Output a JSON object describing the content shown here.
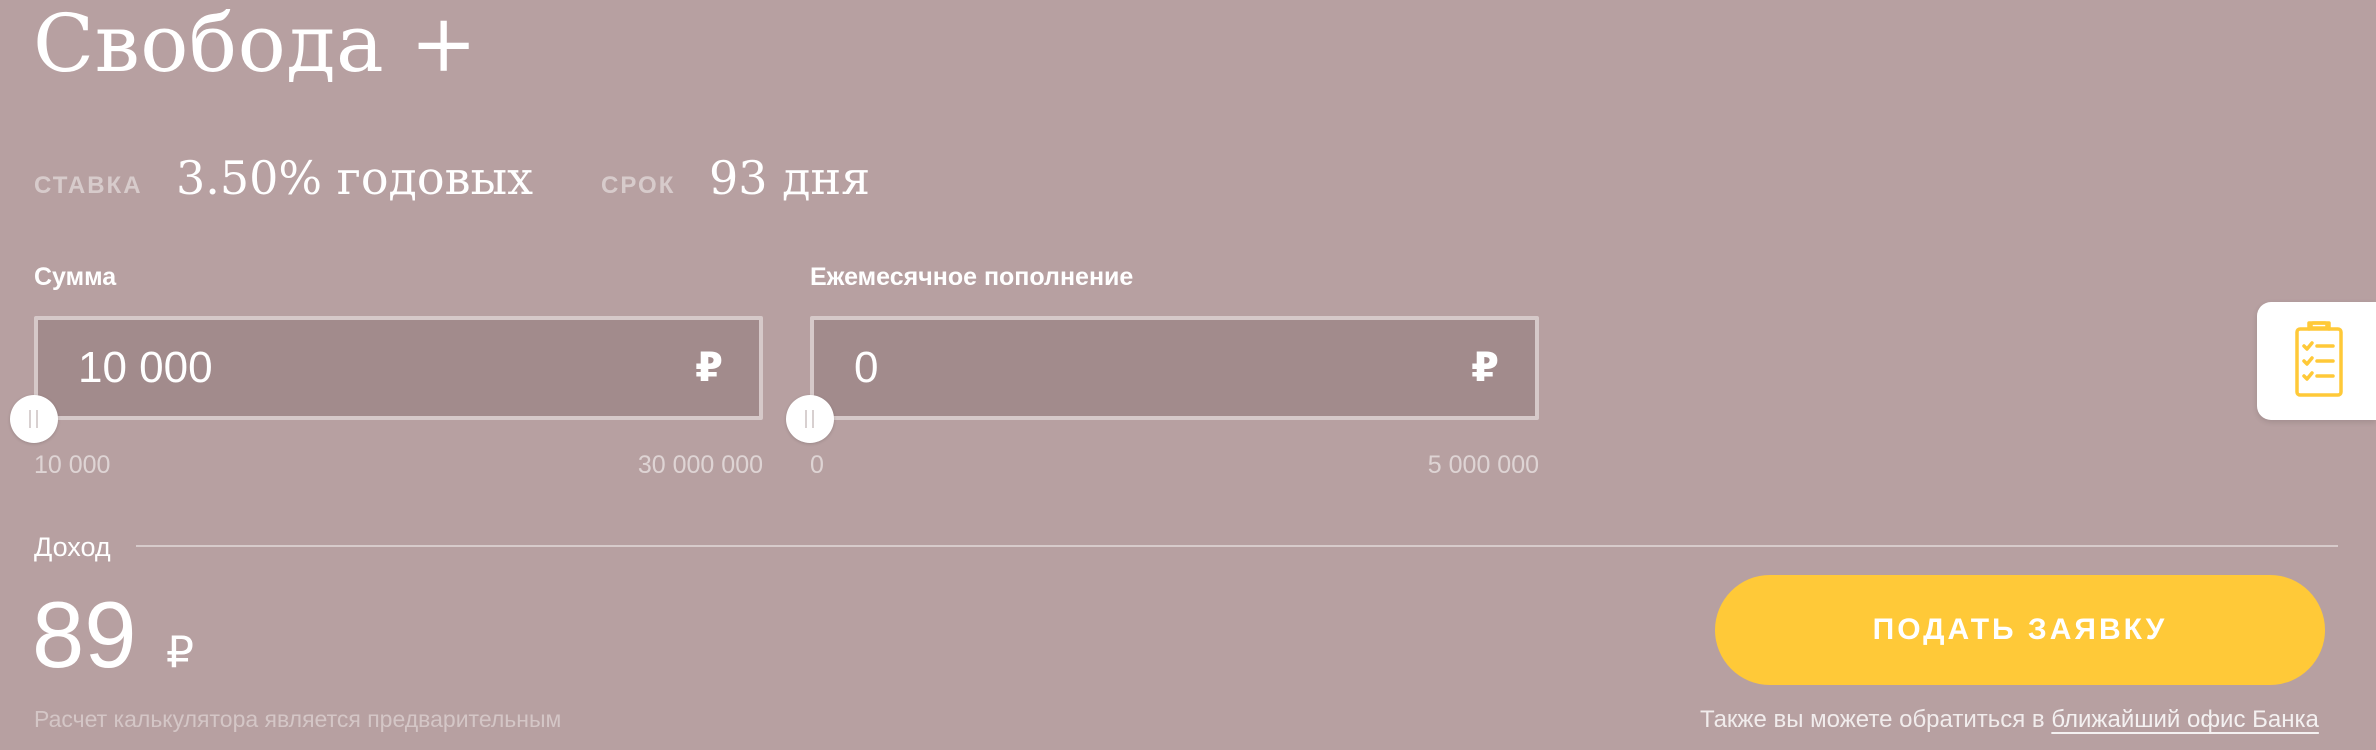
{
  "product": {
    "title": "Свобода +"
  },
  "terms": {
    "rate_label": "СТАВКА",
    "rate_value": "3.50% годовых",
    "term_label": "СРОК",
    "term_value": "93 дня"
  },
  "sum_field": {
    "label": "Сумма",
    "value": "10 000",
    "currency": "₽",
    "min_label": "10 000",
    "max_label": "30 000 000",
    "slider_fraction": 0
  },
  "monthly_field": {
    "label": "Ежемесячное пополнение",
    "value": "0",
    "currency": "₽",
    "min_label": "0",
    "max_label": "5 000 000",
    "slider_fraction": 0
  },
  "income": {
    "label": "Доход",
    "value": "89",
    "currency": "₽"
  },
  "disclaimer": "Расчет калькулятора является предварительным",
  "apply_button": {
    "label": "ПОДАТЬ ЗАЯВКУ"
  },
  "contact": {
    "text": "Также вы можете обратиться в",
    "link": "ближайший офис Банка"
  },
  "side_tab": {
    "icon": "clipboard-checklist-icon"
  },
  "colors": {
    "background": "#b7a0a1",
    "input_background": "#a28b8c",
    "input_border": "#d6c9c9",
    "accent": "#ffc938"
  }
}
